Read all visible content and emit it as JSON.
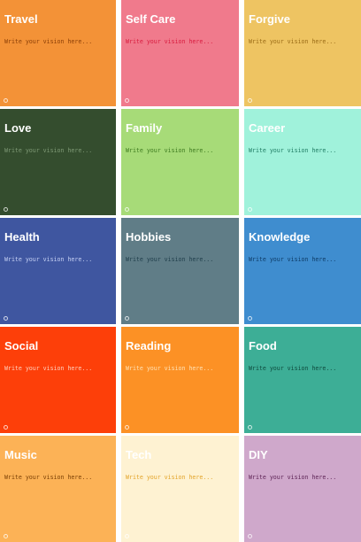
{
  "vision_board": {
    "tiles": [
      {
        "title": "Travel",
        "placeholder": "Write your vision here...",
        "bg": "#F39237",
        "text_color": "#8A3E06"
      },
      {
        "title": "Self Care",
        "placeholder": "Write your vision here...",
        "bg": "#F07A8C",
        "text_color": "#D81B3E"
      },
      {
        "title": "Forgive",
        "placeholder": "Write your vision here...",
        "bg": "#EEC462",
        "text_color": "#9A6B16"
      },
      {
        "title": "Love",
        "placeholder": "Write your vision here...",
        "bg": "#344D2E",
        "text_color": "#7F9A76"
      },
      {
        "title": "Family",
        "placeholder": "Write your vision here...",
        "bg": "#A7DB78",
        "text_color": "#3D7A1F"
      },
      {
        "title": "Career",
        "placeholder": "Write your vision here...",
        "bg": "#A0F2DB",
        "text_color": "#1F7C63"
      },
      {
        "title": "Health",
        "placeholder": "Write your vision here...",
        "bg": "#3F56A0",
        "text_color": "#C6D1F4"
      },
      {
        "title": "Hobbies",
        "placeholder": "Write your vision here...",
        "bg": "#607D87",
        "text_color": "#1E3D4A"
      },
      {
        "title": "Knowledge",
        "placeholder": "Write your vision here...",
        "bg": "#3F8DCF",
        "text_color": "#0D3B66"
      },
      {
        "title": "Social",
        "placeholder": "Write your vision here...",
        "bg": "#FD3F09",
        "text_color": "#FFD1BF"
      },
      {
        "title": "Reading",
        "placeholder": "Write your vision here...",
        "bg": "#FC9125",
        "text_color": "#FFE2B5"
      },
      {
        "title": "Food",
        "placeholder": "Write your vision here...",
        "bg": "#3DAE96",
        "text_color": "#0E4A3D"
      },
      {
        "title": "Music",
        "placeholder": "Write your vision here...",
        "bg": "#FCB256",
        "text_color": "#7A3F04"
      },
      {
        "title": "Tech",
        "placeholder": "Write your vision here...",
        "bg": "#FEF2D2",
        "text_color": "#E3A42A"
      },
      {
        "title": "DIY",
        "placeholder": "Write your vision here...",
        "bg": "#CFA8CB",
        "text_color": "#5E2456"
      }
    ]
  }
}
